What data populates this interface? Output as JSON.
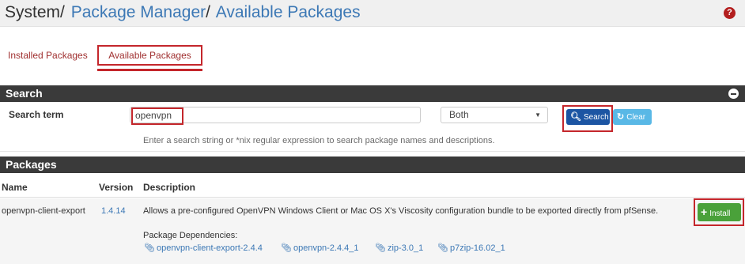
{
  "breadcrumb": {
    "root": "System",
    "sep": "/",
    "item1": "Package Manager",
    "item2": "Available Packages"
  },
  "tabs": {
    "installed": "Installed Packages",
    "available": "Available Packages"
  },
  "search_panel": {
    "title": "Search",
    "label": "Search term",
    "input_value": "openvpn",
    "select_value": "Both",
    "search_button": "Search",
    "clear_button": "Clear",
    "hint": "Enter a search string or *nix regular expression to search package names and descriptions."
  },
  "packages_panel": {
    "title": "Packages",
    "columns": {
      "name": "Name",
      "version": "Version",
      "description": "Description"
    },
    "rows": [
      {
        "name": "openvpn-client-export",
        "version": "1.4.14",
        "description": "Allows a pre-configured OpenVPN Windows Client or Mac OS X's Viscosity configuration bundle to be exported directly from pfSense.",
        "deps_label": "Package Dependencies:",
        "deps": [
          "openvpn-client-export-2.4.4",
          "openvpn-2.4.4_1",
          "zip-3.0_1",
          "p7zip-16.02_1"
        ],
        "install_button": "Install"
      }
    ]
  },
  "colors": {
    "header_bar": "#3a3a3a",
    "highlight": "#c4262b",
    "link": "#3c78b5",
    "search_btn": "#1c55a3",
    "clear_btn": "#59b8e6",
    "install_btn": "#4aa13a"
  }
}
